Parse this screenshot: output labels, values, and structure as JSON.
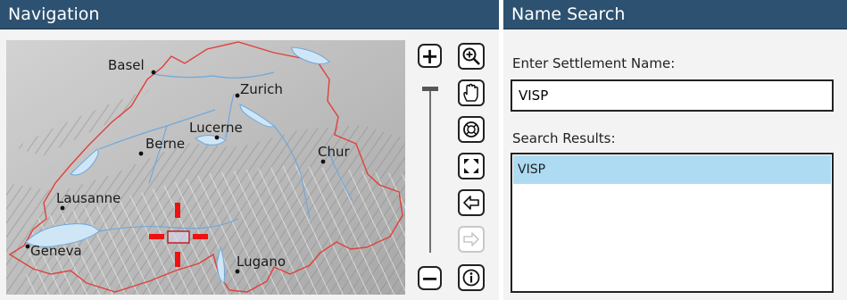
{
  "navigation": {
    "title": "Navigation",
    "map": {
      "cities": [
        {
          "name": "Basel"
        },
        {
          "name": "Zurich"
        },
        {
          "name": "Lucerne"
        },
        {
          "name": "Berne"
        },
        {
          "name": "Chur"
        },
        {
          "name": "Lausanne"
        },
        {
          "name": "Geneva"
        },
        {
          "name": "Lugano"
        }
      ]
    },
    "zoom": {
      "in_label": "+",
      "out_label": "−",
      "level": 1.0
    },
    "tools": [
      {
        "icon": "magnifier-plus-icon",
        "enabled": true
      },
      {
        "icon": "hand-pan-icon",
        "enabled": true
      },
      {
        "icon": "full-extent-icon",
        "enabled": true
      },
      {
        "icon": "zoom-to-extent-icon",
        "enabled": true
      },
      {
        "icon": "back-arrow-icon",
        "enabled": true
      },
      {
        "icon": "forward-arrow-icon",
        "enabled": false
      },
      {
        "icon": "info-icon",
        "enabled": true
      }
    ]
  },
  "search": {
    "title": "Name Search",
    "input_label": "Enter Settlement Name:",
    "input_value": "VISP",
    "results_label": "Search Results:",
    "results": [
      "VISP"
    ],
    "selected_index": 0
  },
  "colors": {
    "titlebar": "#2d5170",
    "border_red": "#e0403a",
    "river_blue": "#6fa8dc",
    "lake_blue": "#cfe6f7",
    "selection": "#aedbf1",
    "marker_red": "#ee1111"
  }
}
